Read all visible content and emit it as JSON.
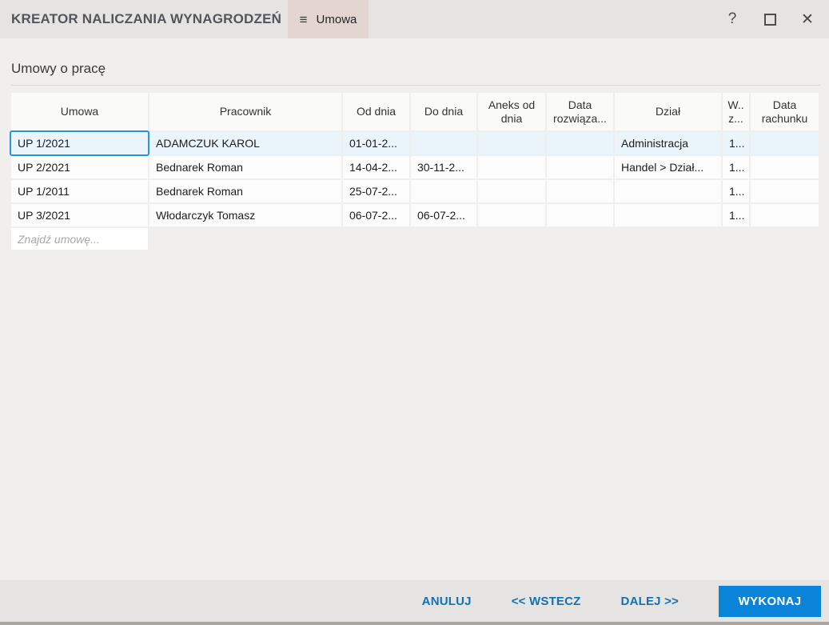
{
  "window": {
    "title": "KREATOR NALICZANIA WYNAGRODZEŃ",
    "icons": {
      "menu": "≡",
      "help": "?",
      "close": "✕"
    }
  },
  "tab": {
    "label": "Umowa"
  },
  "section": {
    "title": "Umowy o pracę"
  },
  "table": {
    "columns": [
      "Umowa",
      "Pracownik",
      "Od dnia",
      "Do dnia",
      "Aneks od dnia",
      "Data rozwiąza...",
      "Dział",
      "W.. z...",
      "Data rachunku"
    ],
    "rows": [
      [
        "UP 1/2021",
        "ADAMCZUK KAROL",
        "01-01-2...",
        "",
        "",
        "",
        "Administracja",
        "1...",
        ""
      ],
      [
        "UP 2/2021",
        "Bednarek Roman",
        "14-04-2...",
        "30-11-2...",
        "",
        "",
        "Handel > Dział...",
        "1...",
        ""
      ],
      [
        "UP 1/2011",
        "Bednarek Roman",
        "25-07-2...",
        "",
        "",
        "",
        "",
        "1...",
        ""
      ],
      [
        "UP 3/2021",
        "Włodarczyk Tomasz",
        "06-07-2...",
        "06-07-2...",
        "",
        "",
        "",
        "1...",
        ""
      ]
    ],
    "filter_placeholder": "Znajdź umowę..."
  },
  "footer": {
    "cancel": "ANULUJ",
    "back": "<< WSTECZ",
    "next": "DALEJ >>",
    "execute": "WYKONAJ"
  },
  "colors": {
    "accent": "#0a84d8",
    "selection_border": "#2795da",
    "selected_row_bg": "#e9f4fb",
    "tab_bg": "#e3d6d1",
    "link_text": "#1371b1"
  }
}
